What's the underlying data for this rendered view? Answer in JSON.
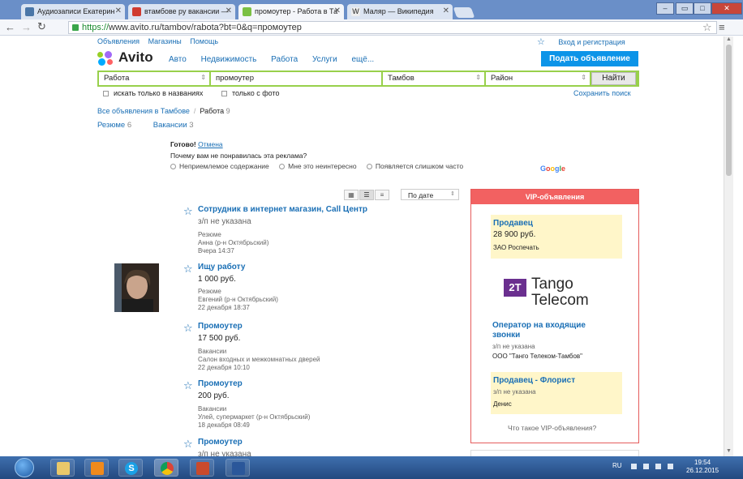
{
  "browser": {
    "tabs": [
      {
        "label": "Аудиозаписи Екатерин",
        "active": false
      },
      {
        "label": "втамбове ру вакансии —",
        "active": false
      },
      {
        "label": "промоутер - Работа в Та",
        "active": true
      },
      {
        "label": "Маляр — Википедия",
        "active": false
      }
    ],
    "url_scheme": "https://",
    "url_rest": "www.avito.ru/tambov/rabota?bt=0&q=промоутер"
  },
  "avito": {
    "toplinks": [
      "Объявления",
      "Магазины",
      "Помощь"
    ],
    "login": "Вход и регистрация",
    "logo": "Avito",
    "nav": [
      "Авто",
      "Недвижимость",
      "Работа",
      "Услуги",
      "ещё..."
    ],
    "post_button": "Подать объявление",
    "search": {
      "category": "Работа",
      "query": "промоутер",
      "city": "Тамбов",
      "district": "Район",
      "find_button": "Найти"
    },
    "check_titles": "искать только в названиях",
    "check_photo": "только с фото",
    "saved_search": "Сохранить поиск",
    "breadcrumb": {
      "all": "Все объявления в Тамбове",
      "sep": "/",
      "current": "Работа",
      "count": "9"
    },
    "cats": [
      {
        "label": "Резюме",
        "count": "6"
      },
      {
        "label": "Вакансии",
        "count": "3"
      }
    ],
    "ad_feedback": {
      "done": "Готово!",
      "cancel": "Отмена",
      "question": "Почему вам не понравилась эта реклама?",
      "options": [
        "Неприемлемое содержание",
        "Мне это неинтересно",
        "Появляется слишком часто"
      ],
      "google": "Google"
    },
    "sort": "По дате",
    "listings": [
      {
        "title": "Сотрудник в интернет магазин, Call Центр",
        "price": "з/п не указана",
        "meta": [
          "Резюме",
          "Анна (р-н Октябрьский)",
          "Вчера 14:37"
        ]
      },
      {
        "title": "Ищу работу",
        "price": "1 000 руб.",
        "meta": [
          "Резюме",
          "Евгений (р-н Октябрьский)",
          "22 декабря 18:37"
        ]
      },
      {
        "title": "Промоутер",
        "price": "17 500 руб.",
        "meta": [
          "Вакансии",
          "Салон входных и межкомнатных дверей",
          "22 декабря 10:10"
        ]
      },
      {
        "title": "Промоутер",
        "price": "200 руб.",
        "meta": [
          "Вакансии",
          "Улей, супермаркет (р-н Октябрьский)",
          "18 декабря 08:49"
        ]
      },
      {
        "title": "Промоутер",
        "price": "з/п не указана",
        "meta": []
      }
    ],
    "vip": {
      "header": "VIP-объявления",
      "ad1": {
        "title": "Продавец",
        "price": "28 900 руб.",
        "company": "ЗАО Роспечать"
      },
      "tango": {
        "mark": "2T",
        "line1": "Tango",
        "line2": "Telecom"
      },
      "ad2": {
        "title": "Оператор на входящие звонки",
        "salary": "з/п не указана",
        "company": "ООО \"Танго Телеком-Тамбов\""
      },
      "ad3": {
        "title": "Продавец - Флорист",
        "salary": "з/п не указана",
        "company": "Денис"
      },
      "what": "Что такое VIP-объявления?"
    }
  },
  "taskbar": {
    "lang": "RU",
    "time": "19:54",
    "date": "26.12.2015"
  }
}
